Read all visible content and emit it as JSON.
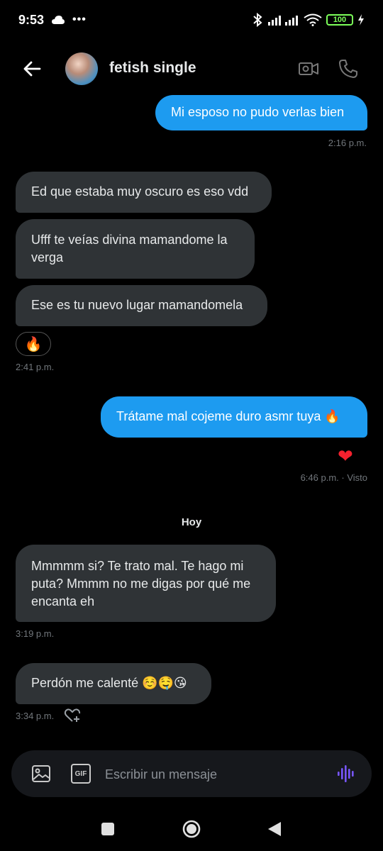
{
  "status": {
    "time": "9:53",
    "battery": "100"
  },
  "header": {
    "name": "fetish single"
  },
  "messages": [
    {
      "text": "Mi esposo no pudo verlas bien",
      "side": "sent"
    },
    {
      "text": "Ed que estaba muy oscuro es eso vdd",
      "side": "received"
    },
    {
      "text": "Ufff te veías divina mamandome la verga",
      "side": "received"
    },
    {
      "text": "Ese es tu nuevo lugar mamandomela",
      "side": "received"
    },
    {
      "text": "Trátame mal cojeme duro asmr tuya 🔥",
      "side": "sent"
    },
    {
      "text": "Mmmmm si? Te trato mal. Te hago mi puta? Mmmm no me digas por qué me encanta eh",
      "side": "received"
    },
    {
      "text": "Perdón me calenté ☺️🤤😘",
      "side": "received"
    }
  ],
  "timestamps": {
    "t1": "2:16 p.m.",
    "t2": "2:41 p.m.",
    "t3": "6:46 p.m. · Visto",
    "t4": "3:19 p.m.",
    "t5": "3:34 p.m."
  },
  "reactions": {
    "fire": "🔥",
    "heart": "❤"
  },
  "day_separator": "Hoy",
  "composer": {
    "placeholder": "Escribir un mensaje",
    "gif_label": "GIF"
  },
  "colors": {
    "sent_bubble": "#1d9bf0",
    "received_bubble": "#2f3336",
    "voice_accent": "#7856ff"
  }
}
